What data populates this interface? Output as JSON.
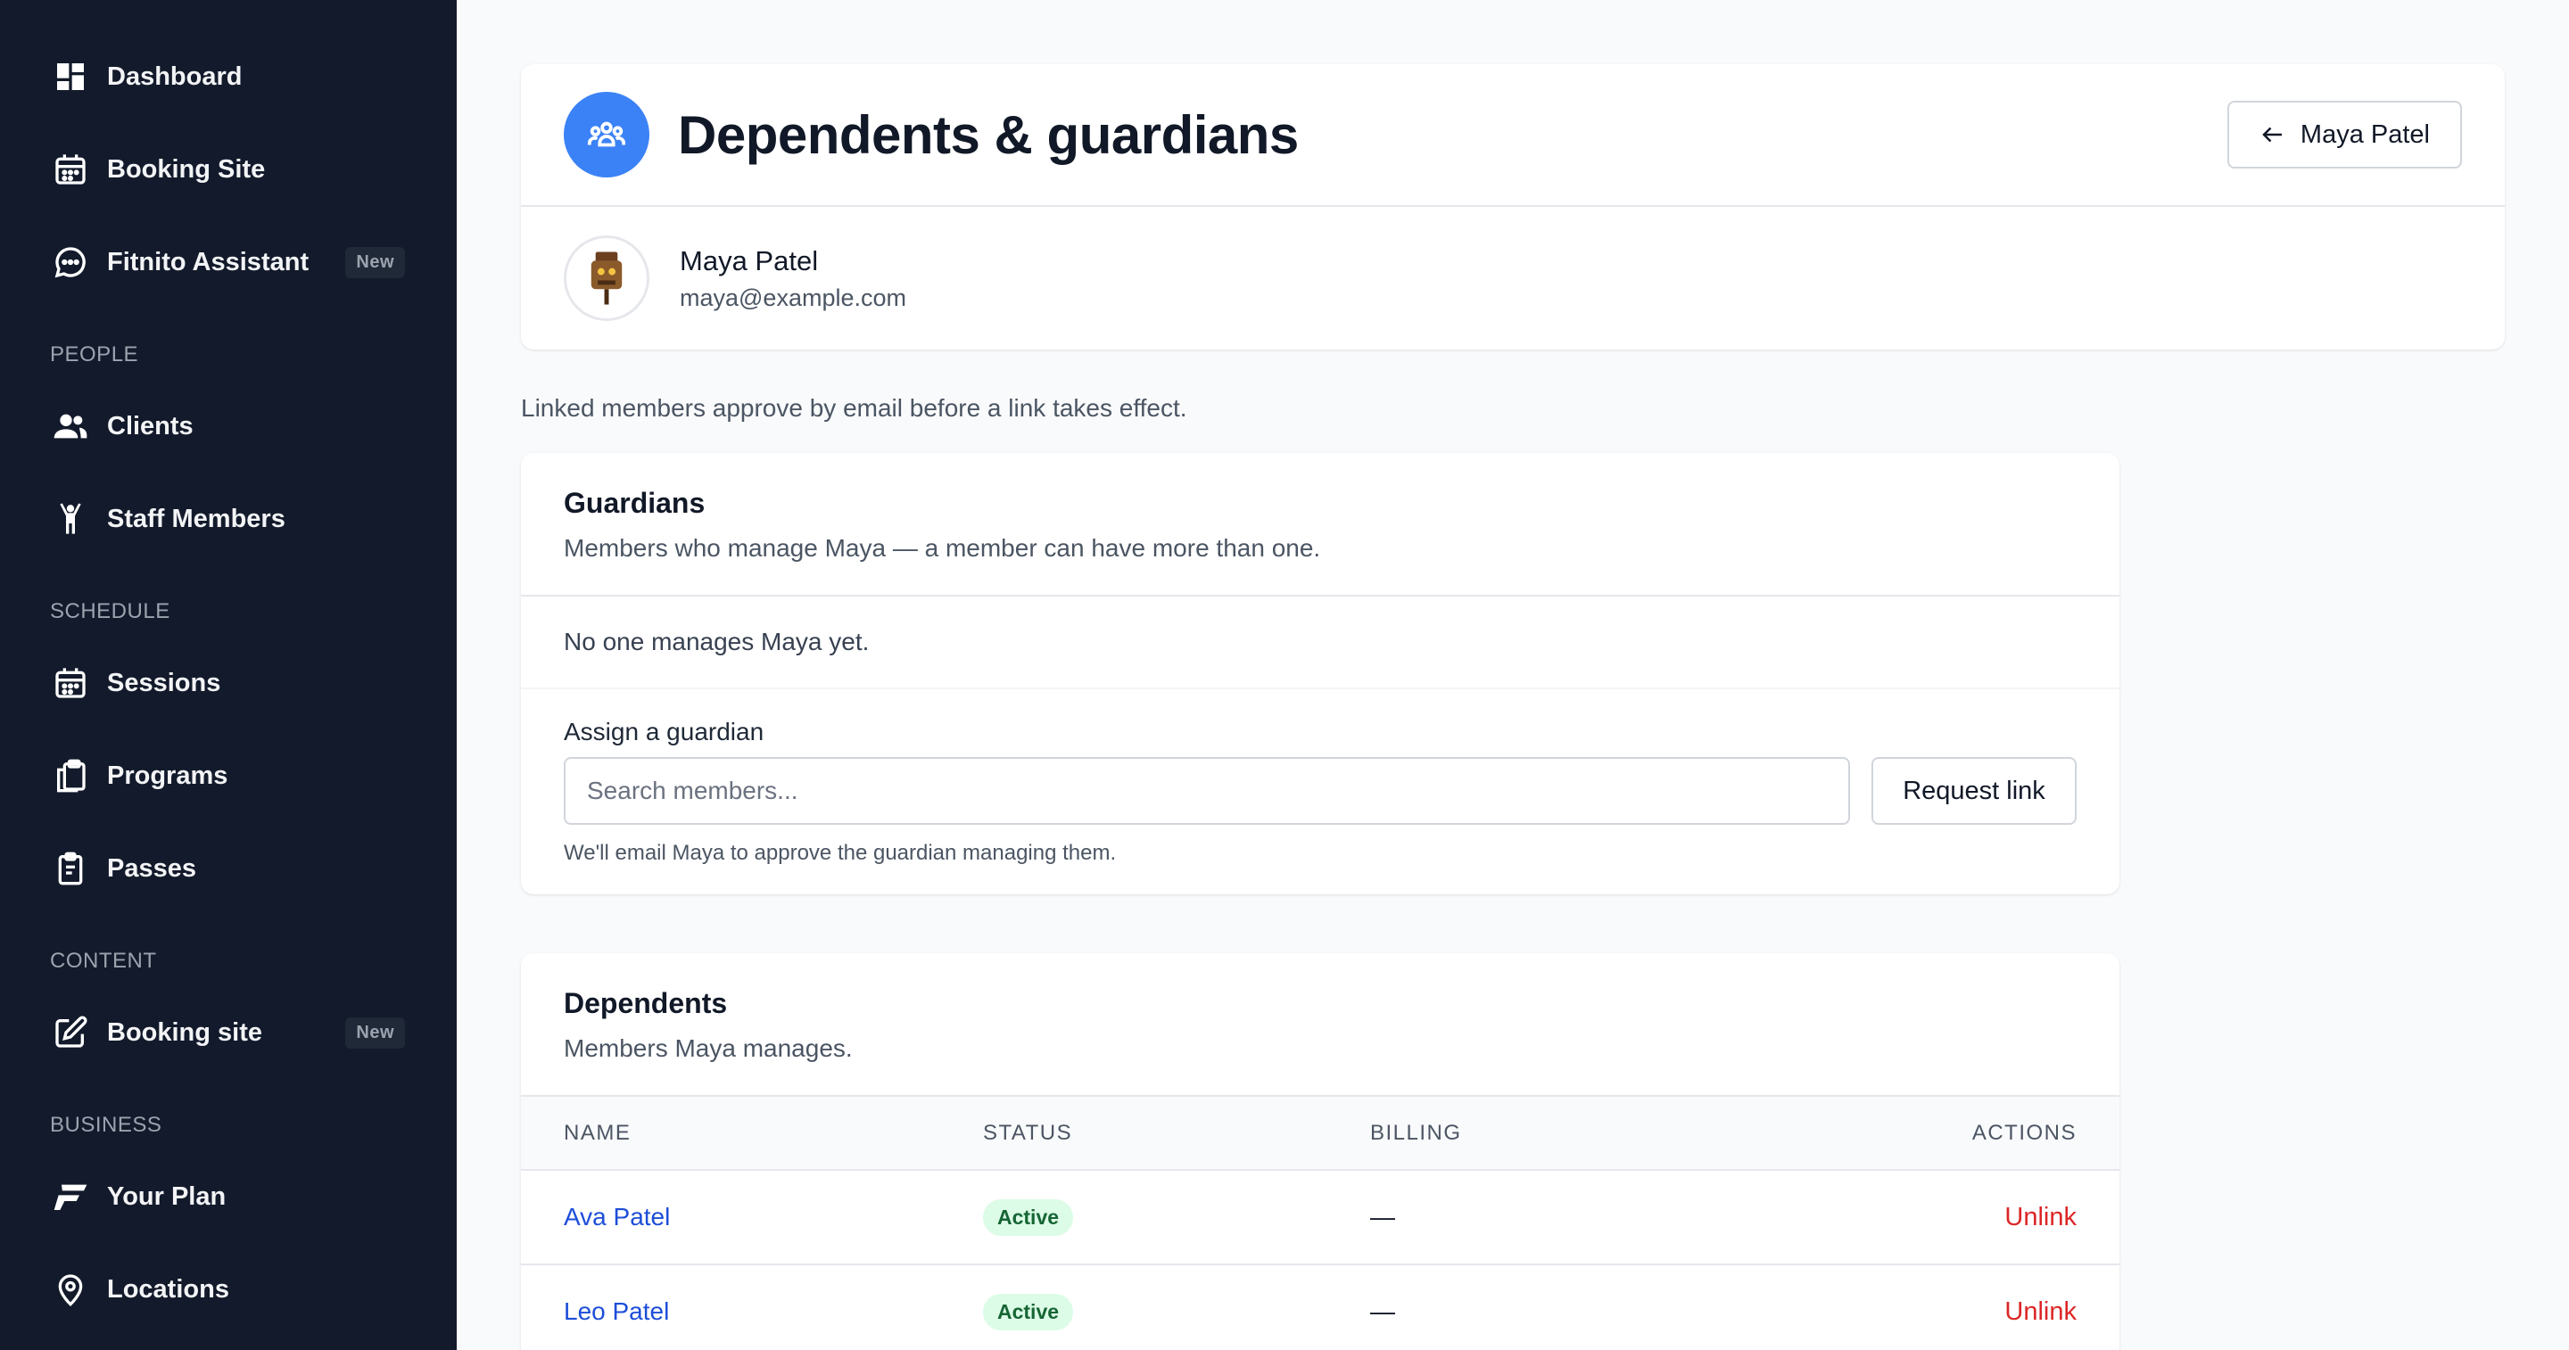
{
  "sidebar": {
    "top_items": [
      {
        "label": "Dashboard",
        "icon": "dashboard-icon"
      },
      {
        "label": "Booking Site",
        "icon": "calendar-icon"
      },
      {
        "label": "Fitnito Assistant",
        "icon": "chat-icon",
        "badge": "New"
      }
    ],
    "sections": [
      {
        "title": "PEOPLE",
        "items": [
          {
            "label": "Clients",
            "icon": "users-icon"
          },
          {
            "label": "Staff Members",
            "icon": "person-arms-up-icon"
          }
        ]
      },
      {
        "title": "SCHEDULE",
        "items": [
          {
            "label": "Sessions",
            "icon": "calendar-icon"
          },
          {
            "label": "Programs",
            "icon": "clipboard-copy-icon"
          },
          {
            "label": "Passes",
            "icon": "clipboard-icon"
          }
        ]
      },
      {
        "title": "CONTENT",
        "items": [
          {
            "label": "Booking site",
            "icon": "edit-icon",
            "badge": "New"
          }
        ]
      },
      {
        "title": "BUSINESS",
        "items": [
          {
            "label": "Your Plan",
            "icon": "brand-f-icon"
          },
          {
            "label": "Locations",
            "icon": "map-pin-icon"
          }
        ]
      }
    ]
  },
  "header": {
    "title": "Dependents & guardians",
    "back_label": "Maya Patel",
    "user_name": "Maya Patel",
    "user_email": "maya@example.com"
  },
  "info_note": "Linked members approve by email before a link takes effect.",
  "guardians": {
    "title": "Guardians",
    "description": "Members who manage Maya — a member can have more than one.",
    "empty_text": "No one manages Maya yet.",
    "assign_label": "Assign a guardian",
    "search_placeholder": "Search members...",
    "request_button": "Request link",
    "help_text": "We'll email Maya to approve the guardian managing them."
  },
  "dependents": {
    "title": "Dependents",
    "description": "Members Maya manages.",
    "columns": [
      "NAME",
      "STATUS",
      "BILLING",
      "ACTIONS"
    ],
    "rows": [
      {
        "name": "Ava Patel",
        "status": "Active",
        "billing": "—",
        "action": "Unlink"
      },
      {
        "name": "Leo Patel",
        "status": "Active",
        "billing": "—",
        "action": "Unlink"
      }
    ]
  },
  "colors": {
    "sidebar_bg": "#121a2b",
    "accent": "#3b82f6",
    "link": "#1d4ed8",
    "danger": "#dc2626",
    "success_bg": "#dcfce7",
    "success_text": "#166534"
  }
}
